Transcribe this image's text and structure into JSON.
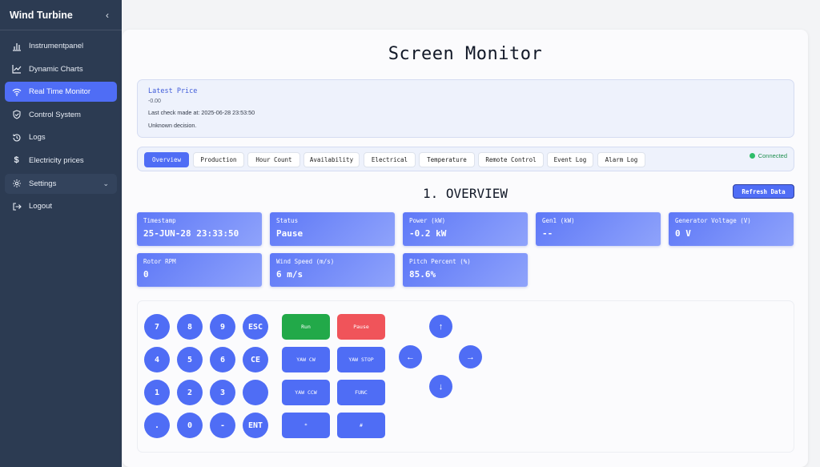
{
  "sidebar": {
    "title": "Wind Turbine",
    "collapse_icon": "‹",
    "items": [
      {
        "label": "Instrumentpanel",
        "icon": "bar-chart-icon"
      },
      {
        "label": "Dynamic Charts",
        "icon": "line-chart-icon"
      },
      {
        "label": "Real Time Monitor",
        "icon": "wifi-icon",
        "active": true
      },
      {
        "label": "Control System",
        "icon": "shield-icon"
      },
      {
        "label": "Logs",
        "icon": "history-icon"
      },
      {
        "label": "Electricity prices",
        "icon": "dollar-icon"
      },
      {
        "label": "Settings",
        "icon": "gear-icon"
      }
    ],
    "logout": "Logout"
  },
  "main": {
    "title": "Screen Monitor",
    "price": {
      "title": "Latest Price",
      "value": "-0.00",
      "last_check": "Last check made at: 2025-06-28 23:53:50",
      "decision": "Unknown decision."
    },
    "tabs": [
      "Overview",
      "Production",
      "Hour Count",
      "Availability",
      "Electrical",
      "Temperature",
      "Remote Control",
      "Event Log",
      "Alarm Log"
    ],
    "active_tab": "Overview",
    "connection": "Connected",
    "section_title": "1. OVERVIEW",
    "refresh": "Refresh Data",
    "metrics": [
      {
        "label": "Timestamp",
        "value": "25-JUN-28 23:33:50"
      },
      {
        "label": "Status",
        "value": "Pause"
      },
      {
        "label": "Power (kW)",
        "value": "-0.2 kW"
      },
      {
        "label": "Gen1 (kW)",
        "value": "--"
      },
      {
        "label": "Generator Voltage (V)",
        "value": "0 V"
      },
      {
        "label": "Rotor RPM",
        "value": "0"
      },
      {
        "label": "Wind Speed (m/s)",
        "value": "6 m/s"
      },
      {
        "label": "Pitch Percent (%)",
        "value": "85.6%"
      }
    ],
    "keypad": [
      "7",
      "8",
      "9",
      "ESC",
      "4",
      "5",
      "6",
      "CE",
      "1",
      "2",
      "3",
      "",
      ".",
      "0",
      "-",
      "ENT"
    ],
    "control_buttons": [
      "Run",
      "Pause",
      "YAW CW",
      "YAW STOP",
      "YAW CCW",
      "FUNC",
      "*",
      "#"
    ],
    "arrows": {
      "up": "↑",
      "left": "←",
      "right": "→",
      "down": "↓"
    }
  },
  "colors": {
    "sidebar_bg": "#2c3b52",
    "accent": "#4f6df5",
    "run": "#22a949",
    "pause": "#f0545a",
    "connected": "#2fbd6a"
  }
}
